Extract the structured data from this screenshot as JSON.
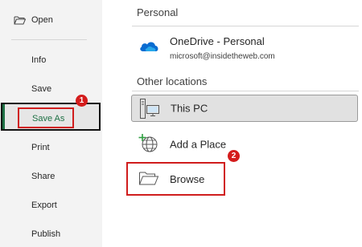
{
  "sidebar": {
    "items": [
      {
        "label": "Open"
      },
      {
        "label": "Info"
      },
      {
        "label": "Save"
      },
      {
        "label": "Save As"
      },
      {
        "label": "Print"
      },
      {
        "label": "Share"
      },
      {
        "label": "Export"
      },
      {
        "label": "Publish"
      }
    ],
    "selected": "Save As"
  },
  "annotations": {
    "badge1": "1",
    "badge2": "2",
    "marker_color": "#d01d1d"
  },
  "main": {
    "personal_heading": "Personal",
    "onedrive": {
      "title": "OneDrive - Personal",
      "email": "microsoft@insidetheweb.com",
      "icon": "onedrive-cloud-icon"
    },
    "other_heading": "Other locations",
    "locations": [
      {
        "label": "This PC",
        "icon": "computer-icon",
        "selected": true
      },
      {
        "label": "Add a Place",
        "icon": "add-place-icon"
      },
      {
        "label": "Browse",
        "icon": "folder-icon"
      }
    ]
  },
  "colors": {
    "accent_green": "#1e7145",
    "sidebar_bg": "#f3f3f3",
    "onedrive_blue": "#0a6cd1"
  }
}
